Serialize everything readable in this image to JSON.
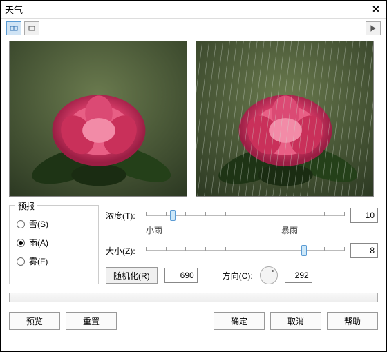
{
  "window": {
    "title": "天气"
  },
  "forecast": {
    "legend": "预报",
    "options": [
      {
        "label": "雪(S)",
        "checked": false
      },
      {
        "label": "雨(A)",
        "checked": true
      },
      {
        "label": "雾(F)",
        "checked": false
      }
    ]
  },
  "sliders": {
    "intensity": {
      "label": "浓度(T):",
      "value": 10,
      "min_label": "小雨",
      "max_label": "暴雨",
      "pos_pct": 12
    },
    "size": {
      "label": "大小(Z):",
      "value": 8,
      "pos_pct": 78
    }
  },
  "randomize": {
    "label": "随机化(R)",
    "seed": 690
  },
  "direction": {
    "label": "方向(C):",
    "value": 292
  },
  "footer": {
    "preview": "预览",
    "reset": "重置",
    "ok": "确定",
    "cancel": "取消",
    "help": "帮助"
  },
  "colors": {
    "accent": "#5a9bd4"
  }
}
